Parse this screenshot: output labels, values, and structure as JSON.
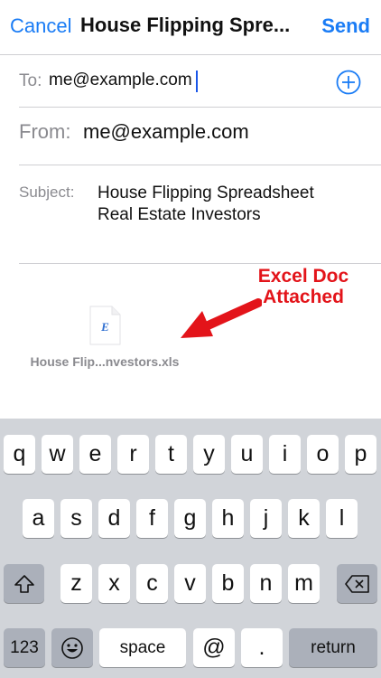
{
  "nav": {
    "cancel": "Cancel",
    "title": "House Flipping Spre...",
    "send": "Send"
  },
  "to": {
    "label": "To:",
    "value": "me@example.com"
  },
  "from": {
    "label": "From:",
    "value": "me@example.com"
  },
  "subject": {
    "label": "Subject:",
    "value": "House Flipping Spreadsheet Real Estate Investors"
  },
  "attachment": {
    "name": "House Flip...nvestors.xls",
    "icon_letter": "E",
    "callout_line1": "Excel Doc",
    "callout_line2": "Attached"
  },
  "colors": {
    "accent": "#1a7cf5",
    "callout": "#e3141a",
    "keyboard_bg": "#d1d4d9"
  },
  "keyboard": {
    "row1": [
      "q",
      "w",
      "e",
      "r",
      "t",
      "y",
      "u",
      "i",
      "o",
      "p"
    ],
    "row2": [
      "a",
      "s",
      "d",
      "f",
      "g",
      "h",
      "j",
      "k",
      "l"
    ],
    "row3": [
      "z",
      "x",
      "c",
      "v",
      "b",
      "n",
      "m"
    ],
    "numbers": "123",
    "space": "space",
    "at": "@",
    "period": ".",
    "return": "return"
  }
}
